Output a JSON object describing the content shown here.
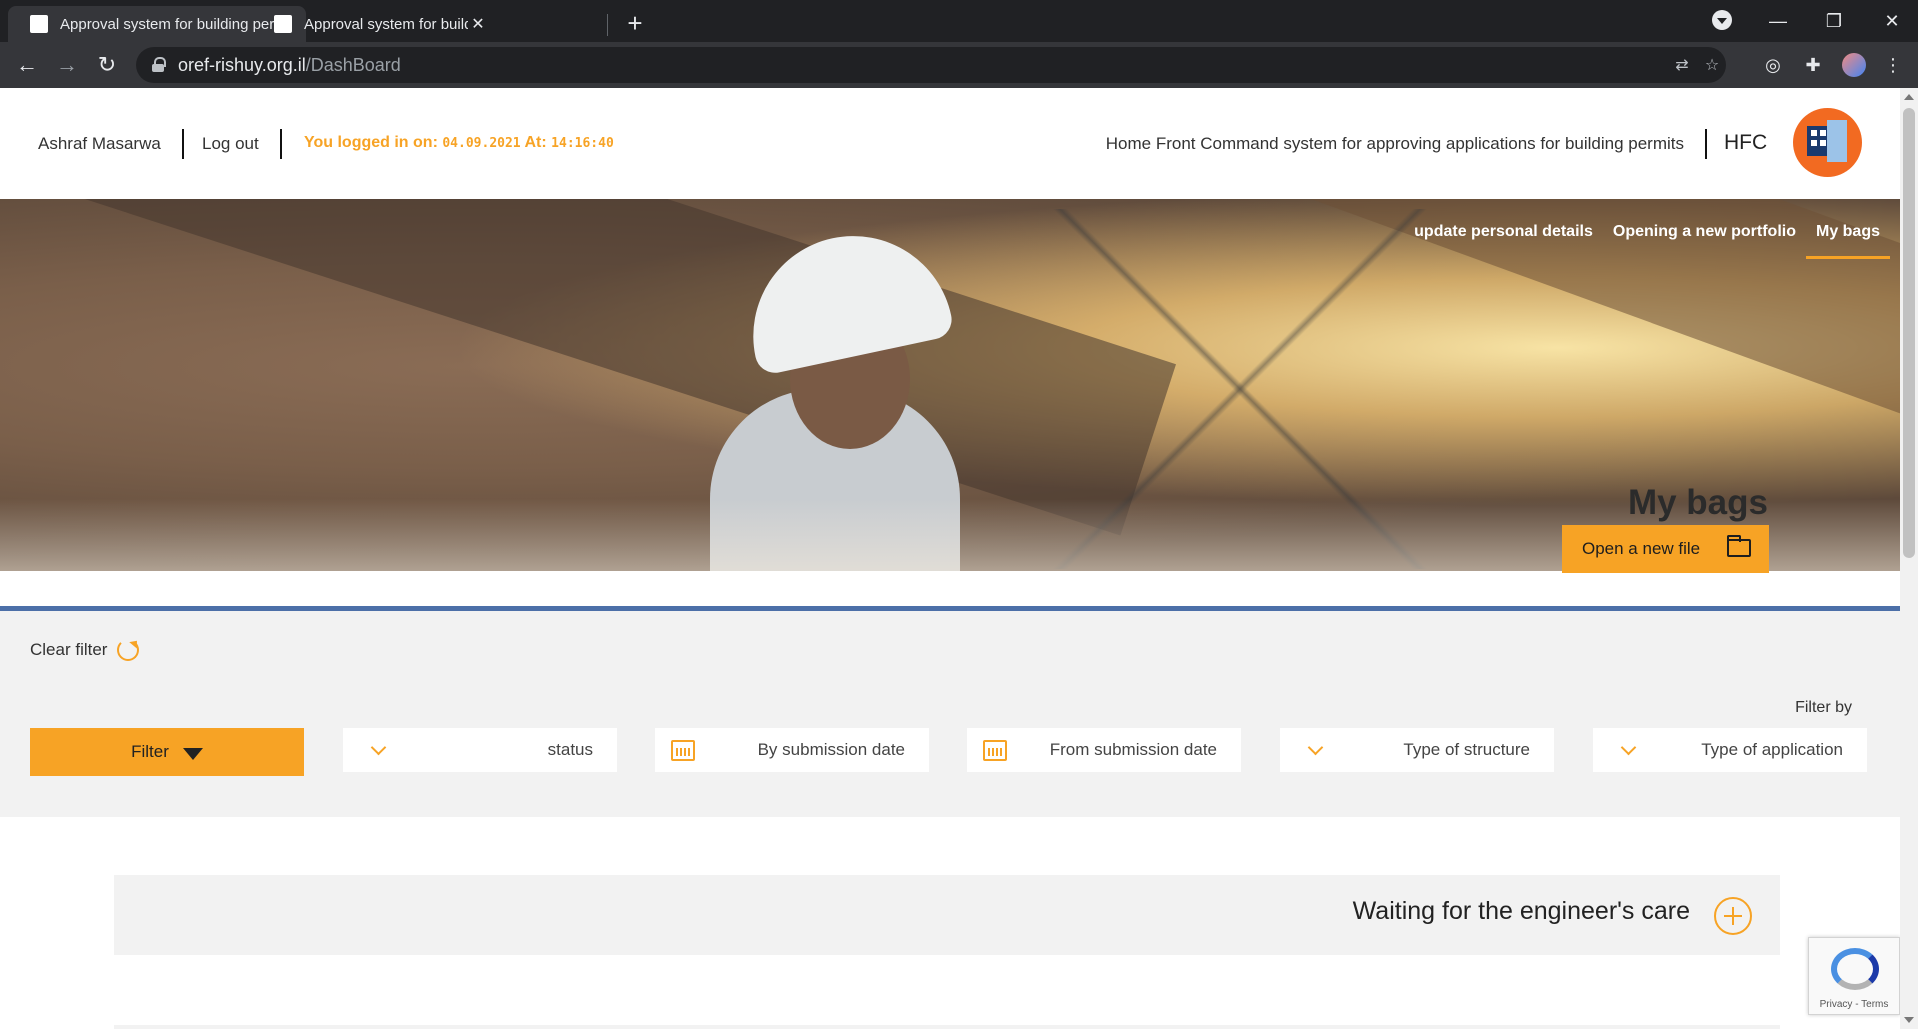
{
  "browser": {
    "tabs": [
      {
        "title": "Approval system for building per"
      },
      {
        "title": "Approval system for building per"
      }
    ],
    "url_host": "oref-rishuy.org.il",
    "url_path": "/DashBoard"
  },
  "header": {
    "user_name": "Ashraf Masarwa",
    "logout_label": "Log out",
    "logged_prefix": "You logged in on:",
    "logged_date": "04.09.2021",
    "logged_at": "At:",
    "logged_time": "14:16:40",
    "system_title": "Home Front Command system for approving applications for building permits",
    "org_abbr": "HFC"
  },
  "hero": {
    "nav": [
      {
        "label": "update personal details"
      },
      {
        "label": "Opening a new portfolio"
      },
      {
        "label": "My bags"
      }
    ],
    "title": "My bags",
    "open_file_label": "Open a new file"
  },
  "filters": {
    "clear_label": "Clear filter",
    "filter_by_label": "Filter by",
    "filter_button_label": "Filter",
    "fields": [
      {
        "label": "status"
      },
      {
        "label": "By submission date"
      },
      {
        "label": "From submission date"
      },
      {
        "label": "Type of structure"
      },
      {
        "label": "Type of application"
      }
    ]
  },
  "list": {
    "groups": [
      {
        "title": "Waiting for the engineer's care"
      }
    ]
  },
  "recaptcha": {
    "label": "Privacy - Terms"
  },
  "colors": {
    "accent": "#f7a325",
    "divider": "#4c6fa8",
    "chrome_dark": "#202124"
  }
}
